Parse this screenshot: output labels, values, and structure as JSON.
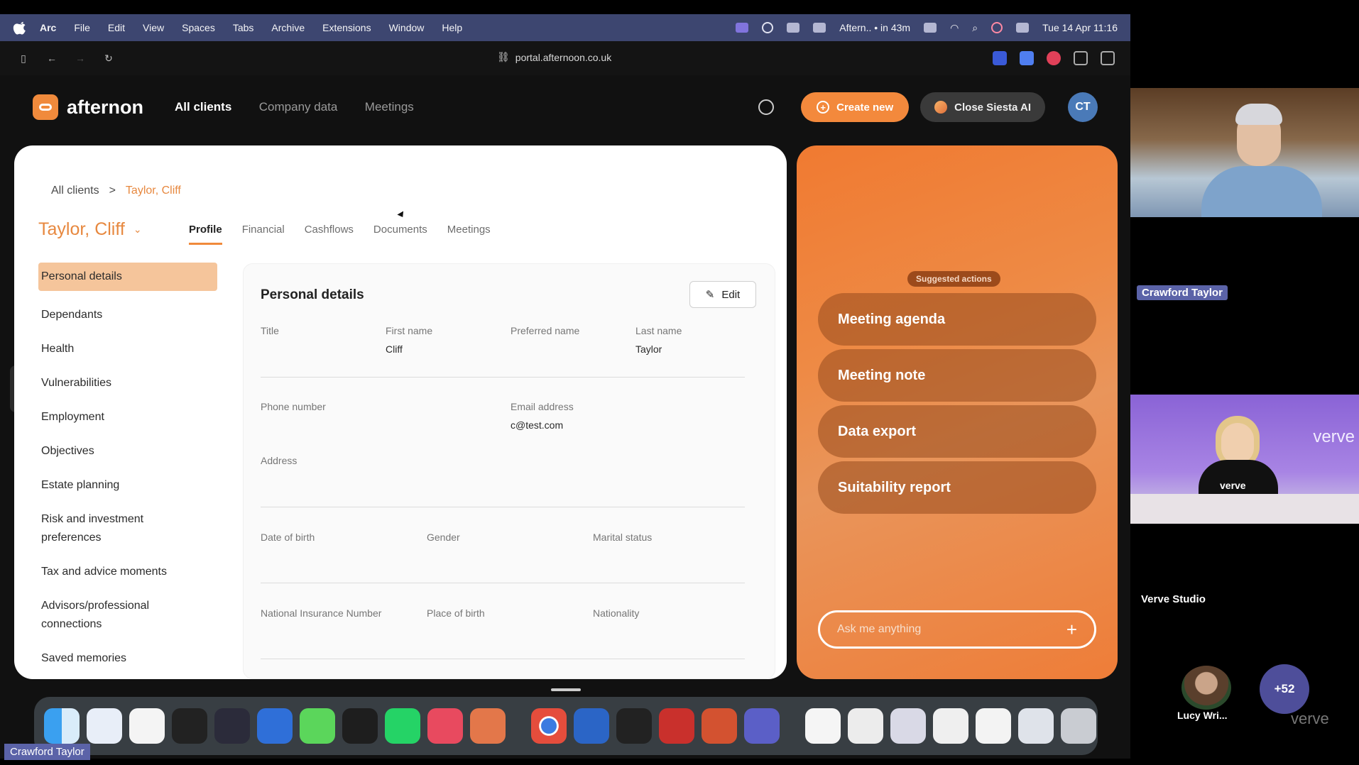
{
  "menubar": {
    "app": "Arc",
    "items": [
      "File",
      "Edit",
      "View",
      "Spaces",
      "Tabs",
      "Archive",
      "Extensions",
      "Window",
      "Help"
    ],
    "event": "Aftern.. • in 43m",
    "datetime": "Tue 14 Apr 11:16"
  },
  "browser": {
    "url": "portal.afternoon.co.uk"
  },
  "app": {
    "logo": "afternon",
    "nav": [
      "All clients",
      "Company data",
      "Meetings"
    ],
    "create_label": "Create new",
    "siesta_label": "Close Siesta AI",
    "avatar_initials": "CT"
  },
  "client": {
    "breadcrumb_root": "All clients",
    "breadcrumb_sep": ">",
    "breadcrumb_current": "Taylor, Cliff",
    "name": "Taylor, Cliff",
    "tabs": [
      "Profile",
      "Financial",
      "Cashflows",
      "Documents",
      "Meetings"
    ],
    "sidenav": [
      "Personal details",
      "Dependants",
      "Health",
      "Vulnerabilities",
      "Employment",
      "Objectives",
      "Estate planning",
      "Risk and investment preferences",
      "Tax and advice moments",
      "Advisors/professional connections",
      "Saved memories"
    ]
  },
  "details": {
    "heading": "Personal details",
    "edit_label": "Edit",
    "title_label": "Title",
    "title_value": "",
    "first_label": "First name",
    "first_value": "Cliff",
    "preferred_label": "Preferred name",
    "preferred_value": "",
    "last_label": "Last name",
    "last_value": "Taylor",
    "phone_label": "Phone number",
    "phone_value": "",
    "email_label": "Email address",
    "email_value": "c@test.com",
    "address_label": "Address",
    "dob_label": "Date of birth",
    "gender_label": "Gender",
    "marital_label": "Marital status",
    "ni_label": "National Insurance Number",
    "pob_label": "Place of birth",
    "nationality_label": "Nationality"
  },
  "ai": {
    "chip": "Suggested actions",
    "actions": [
      "Meeting agenda",
      "Meeting note",
      "Data export",
      "Suitability report"
    ],
    "ask_placeholder": "Ask me anything",
    "ask_plus": "+"
  },
  "call": {
    "participant1": "Crawford Taylor",
    "participant2": "Verve Studio",
    "participant3": "Lucy Wri...",
    "more_count": "+52",
    "self_tag": "Crawford Taylor",
    "brand": "verve",
    "shirt": "verve"
  },
  "colors": {
    "accent": "#f08a3c",
    "menubar": "#3d4670"
  }
}
